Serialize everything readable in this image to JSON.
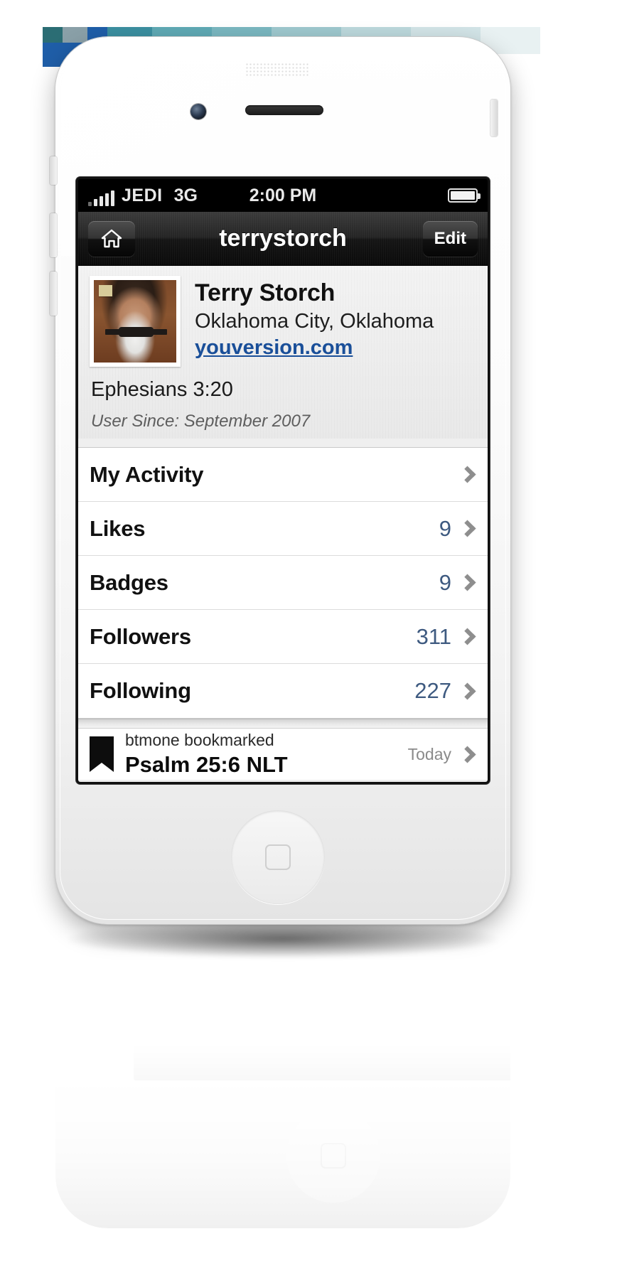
{
  "status_bar": {
    "carrier": "JEDI",
    "network": "3G",
    "time": "2:00 PM",
    "signal_icon": "signal-bars-icon",
    "battery_icon": "battery-icon"
  },
  "nav_bar": {
    "home_icon": "home-icon",
    "title": "terrystorch",
    "edit_label": "Edit"
  },
  "profile": {
    "avatar_alt": "profile-photo",
    "name": "Terry Storch",
    "location": "Oklahoma City, Oklahoma",
    "website": "youversion.com",
    "verse": "Ephesians 3:20",
    "user_since": "User Since: September 2007"
  },
  "menu": {
    "rows": [
      {
        "label": "My Activity",
        "count": ""
      },
      {
        "label": "Likes",
        "count": "9"
      },
      {
        "label": "Badges",
        "count": "9"
      },
      {
        "label": "Followers",
        "count": "311"
      },
      {
        "label": "Following",
        "count": "227"
      }
    ]
  },
  "activity": {
    "icon": "bookmark-icon",
    "line1": "btmone bookmarked",
    "line2": "Psalm 25:6 NLT",
    "date": "Today"
  },
  "colors": {
    "link": "#1a4f99",
    "count": "#3e5a80",
    "chevron": "#8e8e8e",
    "nav_bar": "#1a1a1a"
  }
}
